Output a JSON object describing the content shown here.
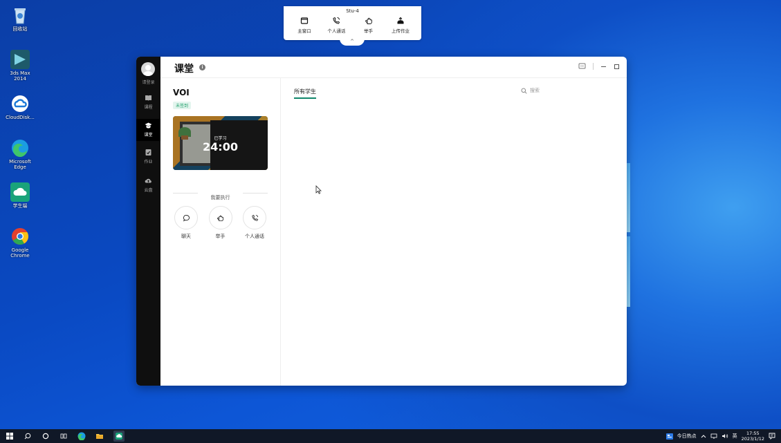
{
  "desktop": {
    "icons": [
      {
        "label": "回收站",
        "icon": "recycle-bin-icon"
      },
      {
        "label": "3ds Max 2014",
        "icon": "3ds-max-icon"
      },
      {
        "label": "CloudDisk...",
        "icon": "cloud-disk-icon"
      },
      {
        "label": "Microsoft Edge",
        "icon": "edge-icon"
      },
      {
        "label": "学生端",
        "icon": "student-client-icon"
      },
      {
        "label": "Google Chrome",
        "icon": "chrome-icon"
      }
    ]
  },
  "toolbar": {
    "title": "Stu-4",
    "buttons": [
      {
        "label": "主窗口",
        "icon": "window-icon"
      },
      {
        "label": "个人通话",
        "icon": "phone-icon"
      },
      {
        "label": "举手",
        "icon": "hand-icon"
      },
      {
        "label": "上传作业",
        "icon": "upload-icon"
      }
    ],
    "collapse": "^"
  },
  "app": {
    "rail": {
      "login": "请登录",
      "items": [
        {
          "label": "课程",
          "icon": "book-icon"
        },
        {
          "label": "课堂",
          "icon": "graduation-cap-icon"
        },
        {
          "label": "作业",
          "icon": "homework-icon"
        },
        {
          "label": "云盘",
          "icon": "cloud-upload-icon"
        }
      ]
    },
    "header": {
      "title": "课堂",
      "info": "i"
    },
    "course": {
      "name": "VOI",
      "status": "未签到",
      "learned_label": "已学习",
      "timer": "24:00"
    },
    "execute_label": "我要执行",
    "actions": [
      {
        "label": "聊天",
        "icon": "chat-icon"
      },
      {
        "label": "举手",
        "icon": "hand-icon"
      },
      {
        "label": "个人通话",
        "icon": "phone-icon"
      }
    ],
    "main": {
      "tab": "所有学生",
      "search_placeholder": "搜索"
    }
  },
  "taskbar": {
    "news": "今日热点",
    "ime": "英",
    "time": "17:55",
    "date": "2023/1/12"
  }
}
